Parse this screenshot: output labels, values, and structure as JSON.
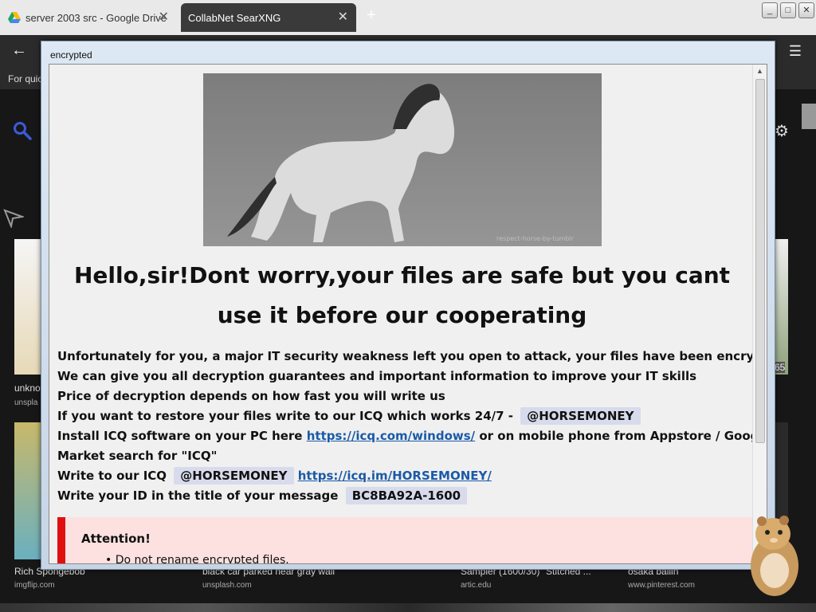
{
  "browser": {
    "tabs": [
      {
        "title": "server 2003 src - Google Drive",
        "close": "✕"
      },
      {
        "title": "CollabNet SearXNG",
        "close": "✕"
      }
    ],
    "new_tab": "+",
    "back_glyph": "←",
    "menu_glyph": "☰",
    "gear_glyph": "⚙",
    "hint_text": "For quic",
    "window_controls": [
      "_",
      "□",
      "✕"
    ]
  },
  "results": [
    {
      "caption": "unkno",
      "source": "unspla"
    },
    {
      "caption": "Rich Spongebob",
      "source": "imgflip.com"
    },
    {
      "caption": "black car parked near gray wall",
      "source": "unsplash.com"
    },
    {
      "caption": "Sampler (1600/30)\" Stitched ...",
      "source": "artic.edu"
    },
    {
      "caption": "osaka ballin",
      "source": "www.pinterest.com"
    }
  ],
  "thumb_badge": "65",
  "popup": {
    "title": "encrypted",
    "scroll_up": "▲",
    "image_watermark": "respect-horse-by-tumblr",
    "heading": "Hello,sir!Dont worry,your files are safe but you cant use it before our cooperating",
    "lines": [
      "Unfortunately for you, a major IT security weakness left you open to attack, your files have been encrypted",
      "We can give you all decryption guarantees and important information to improve your IT skills",
      "Price of decryption depends on how fast you will write us"
    ],
    "restore_text": "If you want to restore your files write to our ICQ which works 24/7 -",
    "icq_handle": "@HORSEMONEY",
    "install_prefix": "Install ICQ software on your PC here",
    "install_link": "https://icq.com/windows/",
    "install_suffix": "or on mobile phone from Appstore / Google Play",
    "market_line": "Market search for \"ICQ\"",
    "write_prefix": "Write to our ICQ",
    "icq_link": "https://icq.im/HORSEMONEY/",
    "id_prefix": "Write your ID in the title of your message",
    "id_value": "BC8BA92A-1600",
    "attention_title": "Attention!",
    "attention_items": [
      "Do not rename encrypted files."
    ]
  },
  "colors": {
    "accent_red": "#e01010",
    "link_blue": "#1a5aa8",
    "chip_bg": "#d8dbec",
    "search_icon_blue": "#3a5bd9"
  }
}
